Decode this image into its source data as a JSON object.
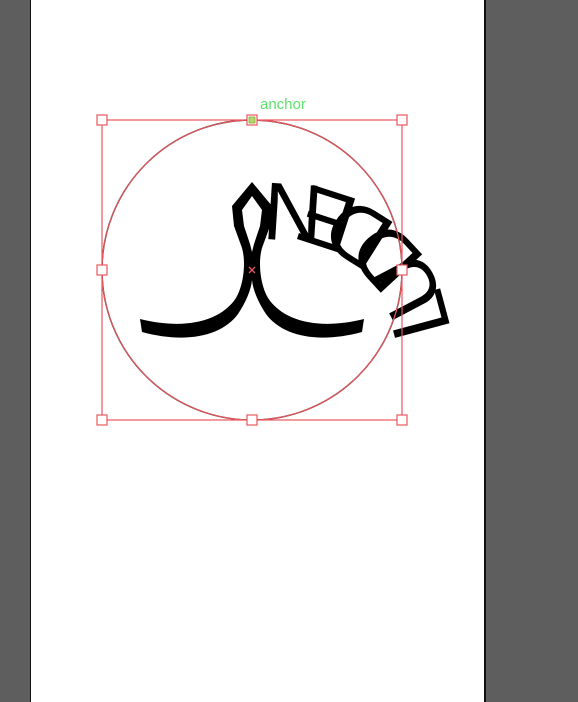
{
  "canvas": {
    "workspace_color": "#5e5e5e",
    "artboard_color": "#ffffff"
  },
  "selection": {
    "anchor_label": "anchor",
    "anchor_label_color": "#5de26b",
    "box_color": "#e8585e",
    "center_marker_color": "#e8585e"
  },
  "artwork": {
    "circular_text": "LUDDEN",
    "ink_color": "#000000"
  }
}
